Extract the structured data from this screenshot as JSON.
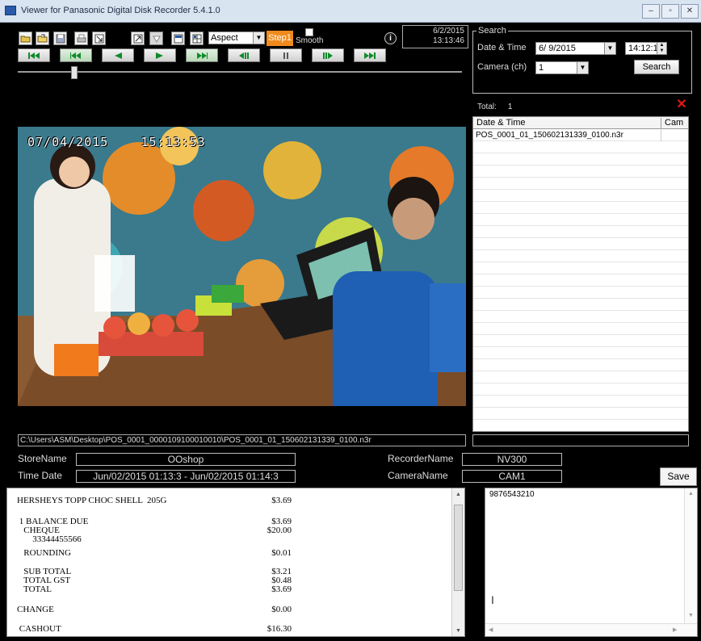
{
  "window": {
    "title": "Viewer for Panasonic Digital Disk Recorder 5.4.1.0"
  },
  "toolbar": {
    "icons": [
      "open-folder-icon",
      "open-file-icon",
      "save-icon",
      "print-icon",
      "export-icon",
      "snapshot-icon",
      "zoom-icon",
      "layout-1-icon",
      "layout-4-icon"
    ],
    "aspect_select": "Aspect",
    "step_button": "Step1",
    "smooth_label": "Smooth",
    "info_label": "i",
    "clock_date": "6/2/2015",
    "clock_time": "13:13:46",
    "step1_color": "#f08a1c"
  },
  "playback": {
    "buttons": [
      "skip-to-start-icon",
      "fast-rewind-icon",
      "reverse-play-icon",
      "play-icon",
      "fast-forward-icon",
      "step-back-icon",
      "pause-icon",
      "step-forward-icon",
      "skip-to-end-icon"
    ],
    "accent_color": "#0f8a2a"
  },
  "search": {
    "legend": "Search",
    "date_time_label": "Date & Time",
    "date_value": "6/ 9/2015",
    "time_value": "14:12:11",
    "camera_label": "Camera (ch)",
    "camera_value": "1",
    "search_button": "Search"
  },
  "video": {
    "osd_date": "07/04/2015",
    "osd_time": "15:13:53"
  },
  "path": "C:\\Users\\ASM\\Desktop\\POS_0001_0000109100010010\\POS_0001_01_150602131339_0100.n3r",
  "filelist": {
    "total_label": "Total:",
    "total_count": "1",
    "columns": [
      "Date & Time",
      "Cam"
    ],
    "rows": [
      {
        "name": "POS_0001_01_150602131339_0100.n3r",
        "cam": ""
      }
    ]
  },
  "info": {
    "store_label": "StoreName",
    "store_value": "OOshop",
    "time_label": "Time Date",
    "time_value": "Jun/02/2015 01:13:3 - Jun/02/2015 01:14:3",
    "recorder_label": "RecorderName",
    "recorder_value": "NV300",
    "camera_label": "CameraName",
    "camera_value": "CAM1",
    "save_button": "Save"
  },
  "receipt": {
    "lines": [
      {
        "left": "HERSHEYS TOPP CHOC SHELL  205G",
        "right": "$3.69"
      },
      {
        "left": " 1 BALANCE DUE",
        "right": "$3.69"
      },
      {
        "left": "   CHEQUE",
        "right": "$20.00"
      },
      {
        "left": "       33344455566",
        "right": ""
      },
      {
        "left": "   ROUNDING",
        "right": "$0.01"
      },
      {
        "left": "   SUB TOTAL",
        "right": "$3.21"
      },
      {
        "left": "   TOTAL GST",
        "right": "$0.48"
      },
      {
        "left": "   TOTAL",
        "right": "$3.69"
      },
      {
        "left": "CHANGE",
        "right": "$0.00"
      },
      {
        "left": " CASHOUT",
        "right": "$16.30"
      }
    ]
  },
  "notes": {
    "text": "9876543210"
  }
}
